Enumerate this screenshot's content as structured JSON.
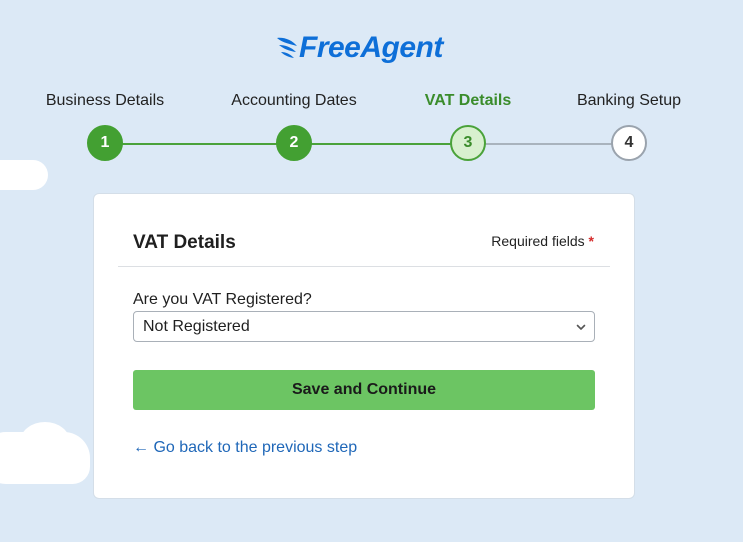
{
  "brand": {
    "name": "FreeAgent",
    "color": "#0e6fd8",
    "icon": "feather-wing-icon"
  },
  "stepper": {
    "steps": [
      {
        "label": "Business Details",
        "number": "1",
        "state": "done"
      },
      {
        "label": "Accounting Dates",
        "number": "2",
        "state": "done"
      },
      {
        "label": "VAT Details",
        "number": "3",
        "state": "current"
      },
      {
        "label": "Banking Setup",
        "number": "4",
        "state": "todo"
      }
    ],
    "colors": {
      "done": "#43a032",
      "current_fill": "#d8f0cf",
      "todo_border": "#9aa3ad"
    }
  },
  "form": {
    "title": "VAT Details",
    "required_note": "Required fields",
    "required_marker": "*",
    "vat_field": {
      "label": "Are you VAT Registered?",
      "value": "Not Registered"
    },
    "submit_label": "Save and Continue",
    "back_link": "← Go back to the previous step"
  },
  "colors": {
    "page_background": "#dce9f6",
    "primary_button": "#6cc563",
    "link": "#1f67b8",
    "required": "#d52b2b"
  }
}
